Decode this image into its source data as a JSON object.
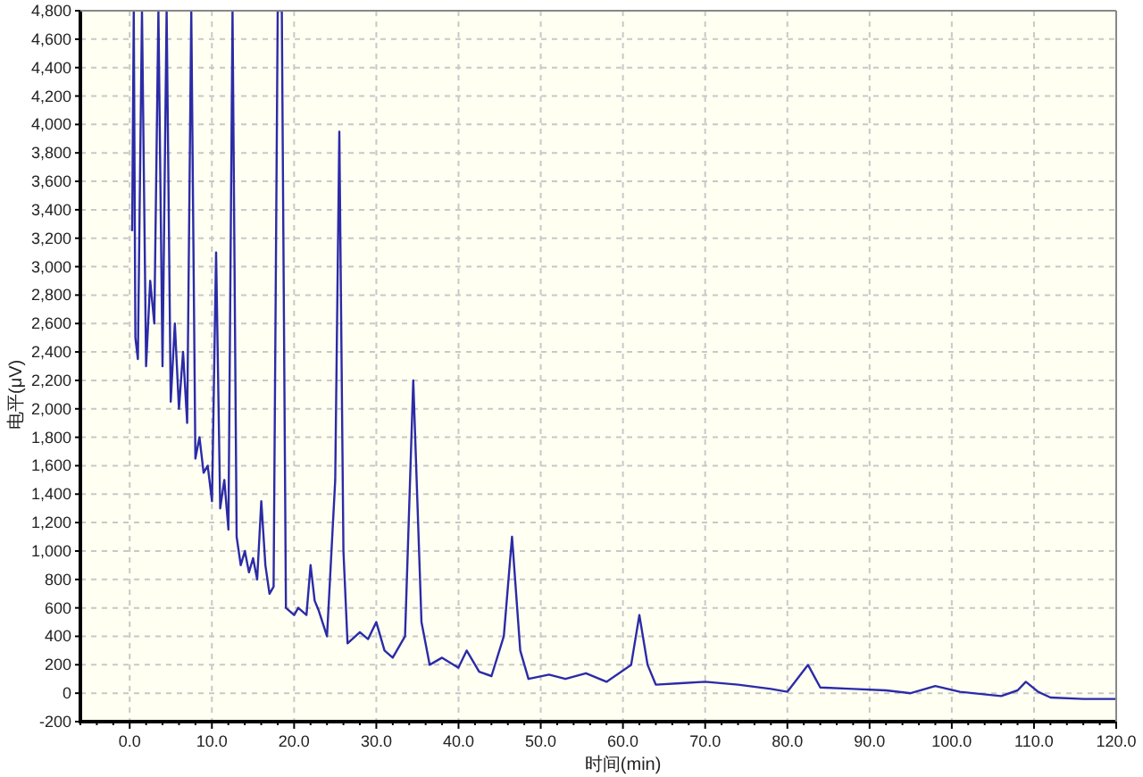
{
  "chart": {
    "chart_data": {
      "type": "line",
      "grid": true,
      "xlabel": "时间(min)",
      "ylabel": "电平(μV)",
      "xlim": [
        -6,
        120
      ],
      "ylim": [
        -200,
        4800
      ],
      "xticks": [
        {
          "value": 0,
          "label": "0.0"
        },
        {
          "value": 10,
          "label": "10.0"
        },
        {
          "value": 20,
          "label": "20.0"
        },
        {
          "value": 30,
          "label": "30.0"
        },
        {
          "value": 40,
          "label": "40.0"
        },
        {
          "value": 50,
          "label": "50.0"
        },
        {
          "value": 60,
          "label": "60.0"
        },
        {
          "value": 70,
          "label": "70.0"
        },
        {
          "value": 80,
          "label": "80.0"
        },
        {
          "value": 90,
          "label": "90.0"
        },
        {
          "value": 100,
          "label": "100.0"
        },
        {
          "value": 110,
          "label": "110.0"
        },
        {
          "value": 120,
          "label": "120.0"
        }
      ],
      "yticks": [
        {
          "value": -200,
          "label": "-200"
        },
        {
          "value": 0,
          "label": "0"
        },
        {
          "value": 200,
          "label": "200"
        },
        {
          "value": 400,
          "label": "400"
        },
        {
          "value": 600,
          "label": "600"
        },
        {
          "value": 800,
          "label": "800"
        },
        {
          "value": 1000,
          "label": "1,000"
        },
        {
          "value": 1200,
          "label": "1,200"
        },
        {
          "value": 1400,
          "label": "1,400"
        },
        {
          "value": 1600,
          "label": "1,600"
        },
        {
          "value": 1800,
          "label": "1,800"
        },
        {
          "value": 2000,
          "label": "2,000"
        },
        {
          "value": 2200,
          "label": "2,200"
        },
        {
          "value": 2400,
          "label": "2,400"
        },
        {
          "value": 2600,
          "label": "2,600"
        },
        {
          "value": 2800,
          "label": "2,800"
        },
        {
          "value": 3000,
          "label": "3,000"
        },
        {
          "value": 3200,
          "label": "3,200"
        },
        {
          "value": 3400,
          "label": "3,400"
        },
        {
          "value": 3600,
          "label": "3,600"
        },
        {
          "value": 3800,
          "label": "3,800"
        },
        {
          "value": 4000,
          "label": "4,000"
        },
        {
          "value": 4200,
          "label": "4,200"
        },
        {
          "value": 4400,
          "label": "4,400"
        },
        {
          "value": 4600,
          "label": "4,600"
        },
        {
          "value": 4800,
          "label": "4,800"
        }
      ],
      "x": [
        0.3,
        0.5,
        0.7,
        1.0,
        1.5,
        2.0,
        2.5,
        3.0,
        3.5,
        4.0,
        4.5,
        5.0,
        5.5,
        6.0,
        6.5,
        7.0,
        7.5,
        8.0,
        8.5,
        9.0,
        9.5,
        10.0,
        10.5,
        11.0,
        11.5,
        12.0,
        12.5,
        13.0,
        13.5,
        14.0,
        14.5,
        15.0,
        15.5,
        16.0,
        16.5,
        17.0,
        17.5,
        18.0,
        18.5,
        19.0,
        20.0,
        20.5,
        21.5,
        22.0,
        22.5,
        23.0,
        24.0,
        25.0,
        25.5,
        26.0,
        26.5,
        28.0,
        29.0,
        30.0,
        31.0,
        32.0,
        33.5,
        34.5,
        35.5,
        36.5,
        38.0,
        40.0,
        41.0,
        42.5,
        44.0,
        45.5,
        46.5,
        47.5,
        48.5,
        51.0,
        53.0,
        55.5,
        58.0,
        61.0,
        62.0,
        63.0,
        64.0,
        67.0,
        70.0,
        74.0,
        78.0,
        80.0,
        82.5,
        84.0,
        88.0,
        92.0,
        95.0,
        98.0,
        101.0,
        106.0,
        108.0,
        109.0,
        110.5,
        112.0,
        116.0,
        120.0
      ],
      "series": [
        {
          "color": "#2b2ba8",
          "values": [
            3250,
            4800,
            2500,
            2350,
            4800,
            2300,
            2900,
            2600,
            4800,
            2300,
            4800,
            2050,
            2600,
            2000,
            2400,
            1900,
            4800,
            1650,
            1800,
            1550,
            1600,
            1350,
            3100,
            1300,
            1500,
            1150,
            4800,
            1100,
            900,
            1000,
            850,
            950,
            800,
            1350,
            900,
            700,
            750,
            4800,
            4800,
            600,
            550,
            600,
            550,
            900,
            650,
            580,
            400,
            1500,
            3950,
            1000,
            350,
            430,
            380,
            500,
            300,
            250,
            400,
            2200,
            500,
            200,
            250,
            180,
            300,
            150,
            120,
            400,
            1100,
            300,
            100,
            130,
            100,
            140,
            80,
            200,
            550,
            200,
            60,
            70,
            80,
            60,
            30,
            10,
            200,
            40,
            30,
            20,
            0,
            50,
            10,
            -20,
            20,
            80,
            10,
            -30,
            -40,
            -40
          ]
        }
      ]
    }
  }
}
